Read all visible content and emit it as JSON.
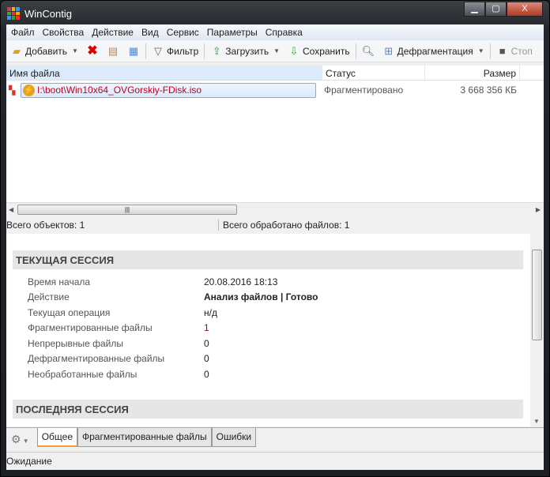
{
  "window": {
    "title": "WinContig",
    "minimize": "▁",
    "maximize": "▢",
    "close": "X"
  },
  "menu": [
    "Файл",
    "Свойства",
    "Действие",
    "Вид",
    "Сервис",
    "Параметры",
    "Справка"
  ],
  "toolbar": {
    "add": "Добавить",
    "filter": "Фильтр",
    "load": "Загрузить",
    "save": "Сохранить",
    "defrag": "Дефрагментация",
    "stop": "Стоп"
  },
  "grid": {
    "columns": [
      "Имя файла",
      "Статус",
      "Размер"
    ],
    "rows": [
      {
        "name": "I:\\boot\\Win10x64_OVGorskiy-FDisk.iso",
        "status": "Фрагментировано",
        "size": "3 668 356 КБ"
      }
    ]
  },
  "summary": {
    "total_objects": "Всего объектов:  1",
    "processed": "Всего обработано файлов: 1"
  },
  "current_session": {
    "title": "ТЕКУЩАЯ СЕССИЯ",
    "items": [
      {
        "k": "Время начала",
        "v": "20.08.2016 18:13"
      },
      {
        "k": "Действие",
        "v": "Анализ файлов | Готово"
      },
      {
        "k": "Текущая операция",
        "v": "н/д"
      },
      {
        "k": "Фрагментированные файлы",
        "v": "1"
      },
      {
        "k": "Непрерывные файлы",
        "v": "0"
      },
      {
        "k": "Дефрагментированные файлы",
        "v": "0"
      },
      {
        "k": "Необработанные файлы",
        "v": "0"
      }
    ]
  },
  "last_session": {
    "title": "ПОСЛЕДНЯЯ СЕССИЯ"
  },
  "tabs": [
    "Общее",
    "Фрагментированные файлы",
    "Ошибки"
  ],
  "status": "Ожидание"
}
